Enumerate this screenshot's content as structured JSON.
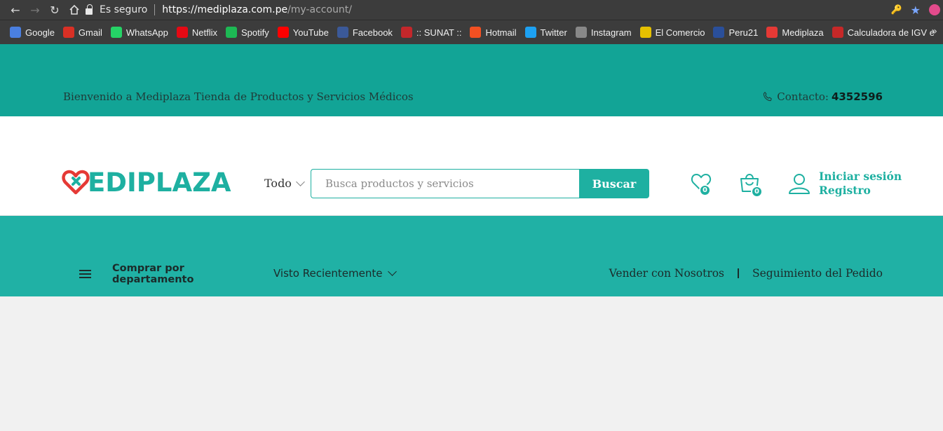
{
  "browser": {
    "secure_label": "Es seguro",
    "url_host": "https://mediplaza.com.pe",
    "url_path": "/my-account/",
    "bookmarks": [
      {
        "label": "Google",
        "icon": "google-icon",
        "color": "#4a7fe0"
      },
      {
        "label": "Gmail",
        "icon": "gmail-icon",
        "color": "#d93025"
      },
      {
        "label": "WhatsApp",
        "icon": "whatsapp-icon",
        "color": "#25d366"
      },
      {
        "label": "Netflix",
        "icon": "netflix-icon",
        "color": "#e50914"
      },
      {
        "label": "Spotify",
        "icon": "spotify-icon",
        "color": "#1db954"
      },
      {
        "label": "YouTube",
        "icon": "youtube-icon",
        "color": "#ff0000"
      },
      {
        "label": "Facebook",
        "icon": "facebook-icon",
        "color": "#3b5998"
      },
      {
        "label": ":: SUNAT ::",
        "icon": "sunat-icon",
        "color": "#c3272b"
      },
      {
        "label": "Hotmail",
        "icon": "hotmail-icon",
        "color": "#f25022"
      },
      {
        "label": "Twitter",
        "icon": "twitter-icon",
        "color": "#1da1f2"
      },
      {
        "label": "Instagram",
        "icon": "instagram-icon",
        "color": "#888888"
      },
      {
        "label": "El Comercio",
        "icon": "elcomercio-icon",
        "color": "#e5c000"
      },
      {
        "label": "Peru21",
        "icon": "peru21-icon",
        "color": "#2a4f9a"
      },
      {
        "label": "Mediplaza",
        "icon": "mediplaza-icon",
        "color": "#e53935"
      },
      {
        "label": "Calculadora de IGV e",
        "icon": "calculadora-icon",
        "color": "#c62828"
      }
    ],
    "more": "»"
  },
  "topbar": {
    "welcome": "Bienvenido a Mediplaza Tienda de Productos y Servicios Médicos",
    "contact_label": "Contacto:",
    "contact_number": "4352596"
  },
  "header": {
    "logo_text": "EDIPLAZA",
    "category": "Todo",
    "search_placeholder": "Busca productos y servicios",
    "search_button": "Buscar",
    "wishlist_count": "0",
    "cart_count": "0",
    "login": "Iniciar sesión",
    "register": "Registro"
  },
  "navbar": {
    "departments": "Comprar por departamento",
    "recent": "Visto Recientemente",
    "sell": "Vender con Nosotros",
    "tracking": "Seguimiento del Pedido"
  },
  "colors": {
    "brand": "#1eb0a1",
    "topbar": "#12a496",
    "navbar": "#20b1a5",
    "logo_heart": "#e53935"
  }
}
